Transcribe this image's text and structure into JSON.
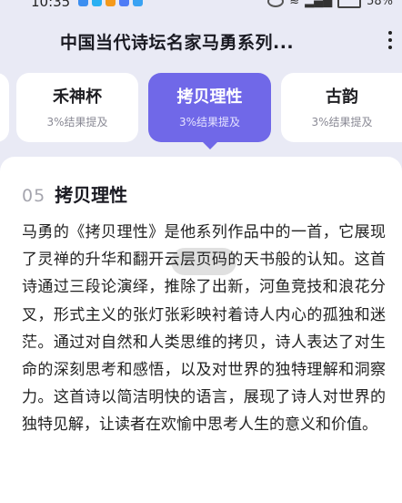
{
  "status_bar": {
    "time": "10:35",
    "battery": "58%"
  },
  "header": {
    "title": "中国当代诗坛名家马勇系列..."
  },
  "tabs": [
    {
      "name": "禾神杯",
      "subtitle": "3%结果提及"
    },
    {
      "name": "拷贝理性",
      "subtitle": "3%结果提及"
    },
    {
      "name": "古韵",
      "subtitle": "3%结果提及"
    }
  ],
  "section": {
    "number": "05",
    "title": "拷贝理性",
    "body": "马勇的《拷贝理性》是他系列作品中的一首，它展现了灵禅的升华和翻开云层页码的天书般的认知。这首诗通过三段论演绎，推除了出新，河鱼竞技和浪花分叉，形式主义的张灯张彩映衬着诗人内心的孤独和迷茫。通过对自然和人类思维的拷贝，诗人表达了对生命的深刻思考和感悟，以及对世界的独特理解和洞察力。这首诗以简洁明快的语言，展现了诗人对世界的独特见解，让读者在欢愉中思考人生的意义和价值。"
  },
  "colors": {
    "accent": "#7068e8",
    "background": "#e9eaf5"
  }
}
